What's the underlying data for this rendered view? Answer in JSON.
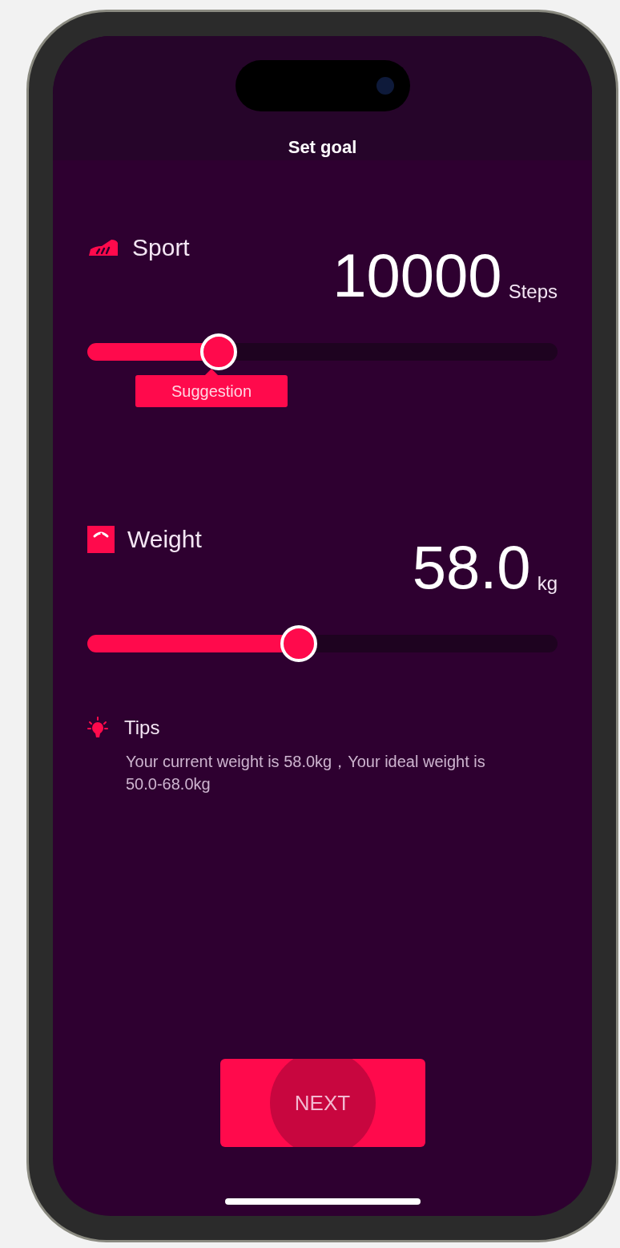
{
  "header": {
    "title": "Set goal"
  },
  "sections": [
    {
      "kind": "sport",
      "label": "Sport",
      "value": "10000",
      "unit": "Steps",
      "level": 0.28,
      "badge": "Suggestion"
    },
    {
      "kind": "weight",
      "label": "Weight",
      "value": "58.0",
      "unit": "kg",
      "level": 0.45
    }
  ],
  "tips": {
    "title": "Tips",
    "text": "Your current weight is 58.0kg，Your ideal weight is 50.0-68.0kg"
  },
  "next_button": {
    "label": "NEXT"
  }
}
